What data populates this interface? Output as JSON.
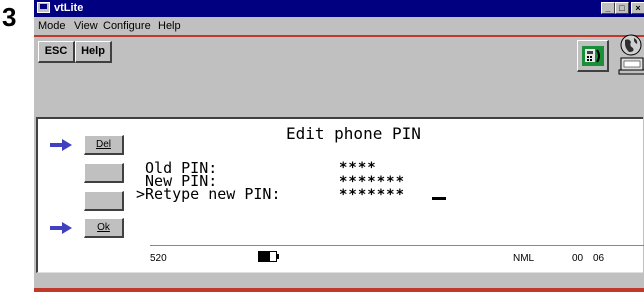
{
  "step_number": "3",
  "window": {
    "title": "vtLite",
    "controls": {
      "minimize": "_",
      "maximize": "□",
      "close": "×"
    }
  },
  "menu": [
    "Mode",
    "View",
    "Configure",
    "Help"
  ],
  "toolbar": {
    "esc_label": "ESC",
    "help_label": "Help"
  },
  "colors": {
    "title_bar": "#000080",
    "accent_red": "#c0392b",
    "arrow": "#4040c0"
  },
  "softkeys": {
    "del_label": "Del",
    "blank1_label": "",
    "blank2_label": "",
    "ok_label": "Ok"
  },
  "screen": {
    "title": "Edit phone PIN",
    "rows": [
      {
        "prefix": " ",
        "label": "Old PIN:",
        "value": "****"
      },
      {
        "prefix": " ",
        "label": "New PIN:",
        "value": "*******"
      },
      {
        "prefix": ">",
        "label": "Retype new PIN:",
        "value": "*******"
      }
    ]
  },
  "status": {
    "number": "520",
    "mode": "NML",
    "hours": "00",
    "minutes": "06"
  },
  "icons": [
    "window-app-icon",
    "phone-icon",
    "globe-network-icon",
    "battery-icon",
    "arrow-right-icon"
  ]
}
